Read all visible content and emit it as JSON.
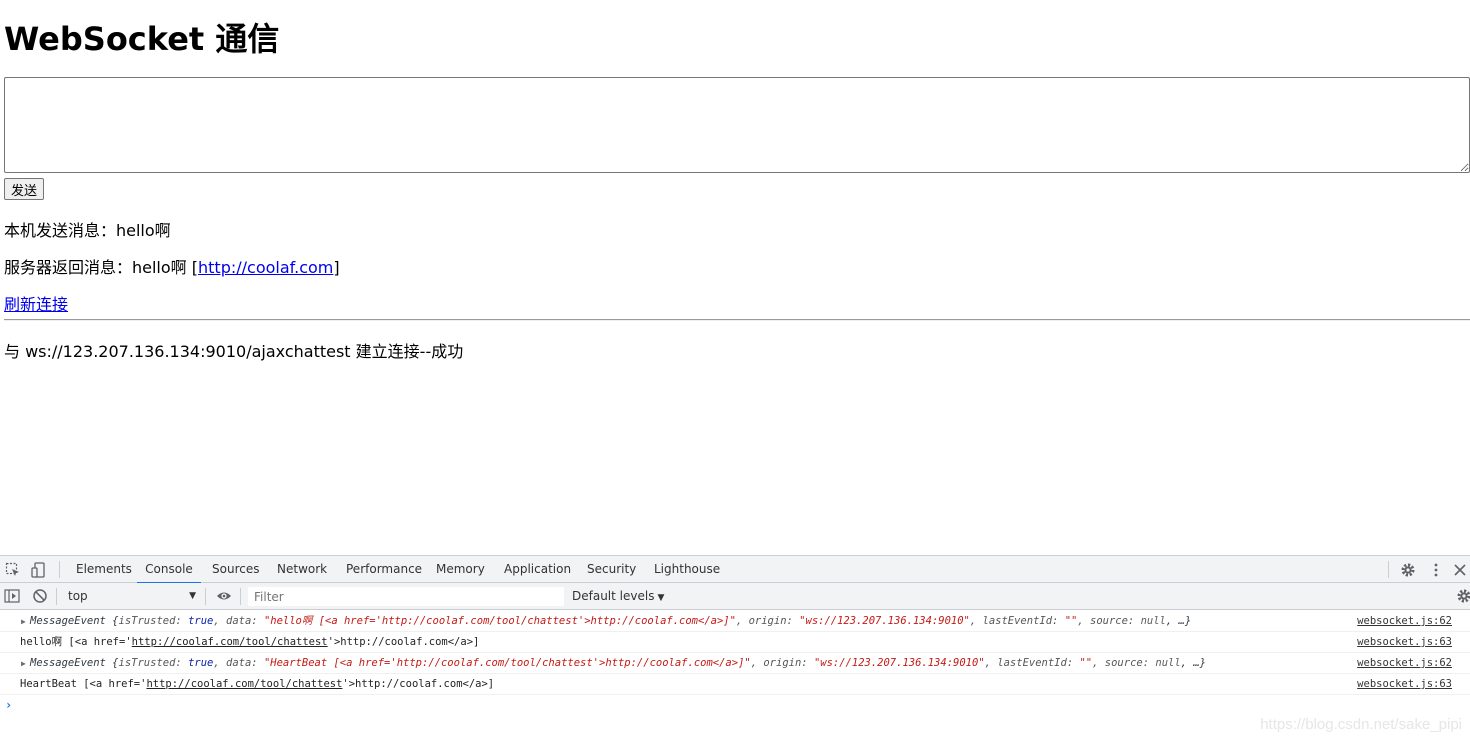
{
  "page": {
    "title": "WebSocket 通信",
    "textarea_value": "",
    "send_label": "发送",
    "local_msg": "本机发送消息：hello啊",
    "server_msg_prefix": "服务器返回消息：hello啊 [",
    "server_msg_link": "http://coolaf.com",
    "server_msg_suffix": "]",
    "refresh_link": "刷新连接",
    "status": "与 ws://123.207.136.134:9010/ajaxchattest 建立连接--成功"
  },
  "devtools": {
    "tabs": [
      "Elements",
      "Console",
      "Sources",
      "Network",
      "Performance",
      "Memory",
      "Application",
      "Security",
      "Lighthouse"
    ],
    "active_tab": "Console",
    "context": "top",
    "filter_placeholder": "Filter",
    "levels": "Default levels",
    "logs": [
      {
        "type": "object",
        "parts": {
          "cls": "MessageEvent {",
          "k1": "isTrusted:",
          "v1": "true",
          "k2": ", data:",
          "v2": "\"hello啊 [<a href='http://coolaf.com/tool/chattest'>http://coolaf.com</a>]\"",
          "k3": ", origin:",
          "v3": "\"ws://123.207.136.134:9010\"",
          "k4": ", lastEventId:",
          "v4": "\"\"",
          "k5": ", source:",
          "v5": "null",
          "end": ", …}"
        },
        "source": "websocket.js:62"
      },
      {
        "type": "text",
        "pre": "hello啊 [<a href='",
        "link": "http://coolaf.com/tool/chattest",
        "post": "'>http://coolaf.com</a>]",
        "source": "websocket.js:63"
      },
      {
        "type": "object",
        "parts": {
          "cls": "MessageEvent {",
          "k1": "isTrusted:",
          "v1": "true",
          "k2": ", data:",
          "v2": "\"HeartBeat [<a href='http://coolaf.com/tool/chattest'>http://coolaf.com</a>]\"",
          "k3": ", origin:",
          "v3": "\"ws://123.207.136.134:9010\"",
          "k4": ", lastEventId:",
          "v4": "\"\"",
          "k5": ", source:",
          "v5": "null",
          "end": ", …}"
        },
        "source": "websocket.js:62"
      },
      {
        "type": "text",
        "pre": "HeartBeat [<a href='",
        "link": "http://coolaf.com/tool/chattest",
        "post": "'>http://coolaf.com</a>]",
        "source": "websocket.js:63"
      }
    ]
  },
  "watermark": "https://blog.csdn.net/sake_pipi",
  "colors": {
    "link": "#0000ee",
    "devtools_bg": "#f1f3f4",
    "accent": "#1a73e8",
    "string": "#c41a16",
    "keyword": "#0d22aa"
  },
  "icons": [
    "inspect-element-icon",
    "device-toolbar-icon",
    "settings-gear-icon",
    "more-vertical-icon",
    "close-icon",
    "sidebar-toggle-icon",
    "clear-console-icon",
    "eye-icon",
    "console-settings-icon",
    "prompt-caret-icon",
    "expand-triangle-icon"
  ]
}
